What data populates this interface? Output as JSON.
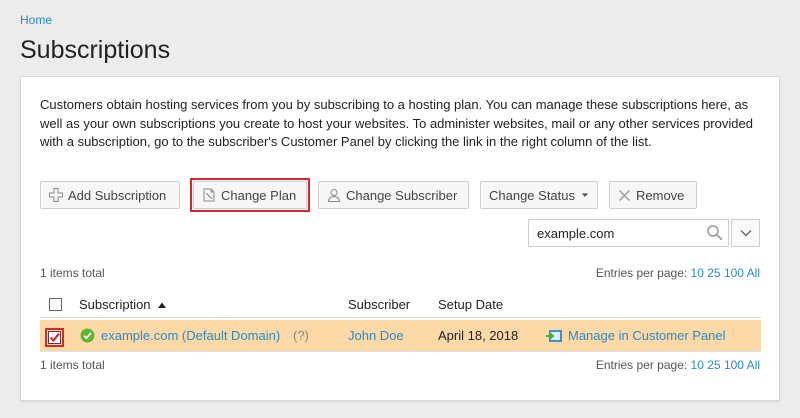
{
  "breadcrumb": "Home",
  "page_title": "Subscriptions",
  "description": "Customers obtain hosting services from you by subscribing to a hosting plan. You can manage these subscriptions here, as well as your own subscriptions you create to host your websites. To administer websites, mail or any other services provided with a subscription, go to the subscriber's Customer Panel by clicking the link in the right column of the list.",
  "toolbar": {
    "add_subscription": "Add Subscription",
    "change_plan": "Change Plan",
    "change_subscriber": "Change Subscriber",
    "change_status": "Change Status",
    "remove": "Remove"
  },
  "search": {
    "value": "example.com"
  },
  "list": {
    "total_top": "1 items total",
    "total_bottom": "1 items total",
    "entries_label": "Entries per page:",
    "page_sizes": [
      "10",
      "25",
      "100",
      "All"
    ],
    "columns": {
      "subscription": "Subscription",
      "subscriber": "Subscriber",
      "setup_date": "Setup Date"
    },
    "rows": [
      {
        "domain": "example.com (Default Domain)",
        "help": "(?)",
        "subscriber": "John Doe",
        "setup_date": "April 18, 2018",
        "action": "Manage in Customer Panel"
      }
    ]
  },
  "colors": {
    "link": "#2a8ac9",
    "selected_row": "#fdd9a8",
    "highlight": "#d9262c",
    "status_ok": "#5cb82f"
  }
}
